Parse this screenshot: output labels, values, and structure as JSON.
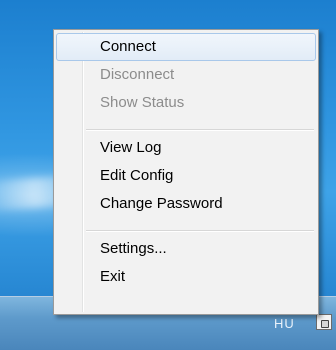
{
  "menu": {
    "items": [
      {
        "label": "Connect",
        "state": "highlighted"
      },
      {
        "label": "Disconnect",
        "state": "disabled"
      },
      {
        "label": "Show Status",
        "state": "disabled"
      },
      {
        "label": "View Log",
        "state": "enabled"
      },
      {
        "label": "Edit Config",
        "state": "enabled"
      },
      {
        "label": "Change Password",
        "state": "enabled"
      },
      {
        "label": "Settings...",
        "state": "enabled"
      },
      {
        "label": "Exit",
        "state": "enabled"
      }
    ]
  },
  "taskbar": {
    "tray_text": "HU",
    "tray_icon": "vpn-lock-icon"
  },
  "colors": {
    "menu_background": "#f2f2f2",
    "highlight_border": "#a9c8ea",
    "disabled_text": "#8c8c8c",
    "desktop_blue": "#2f95e0"
  }
}
